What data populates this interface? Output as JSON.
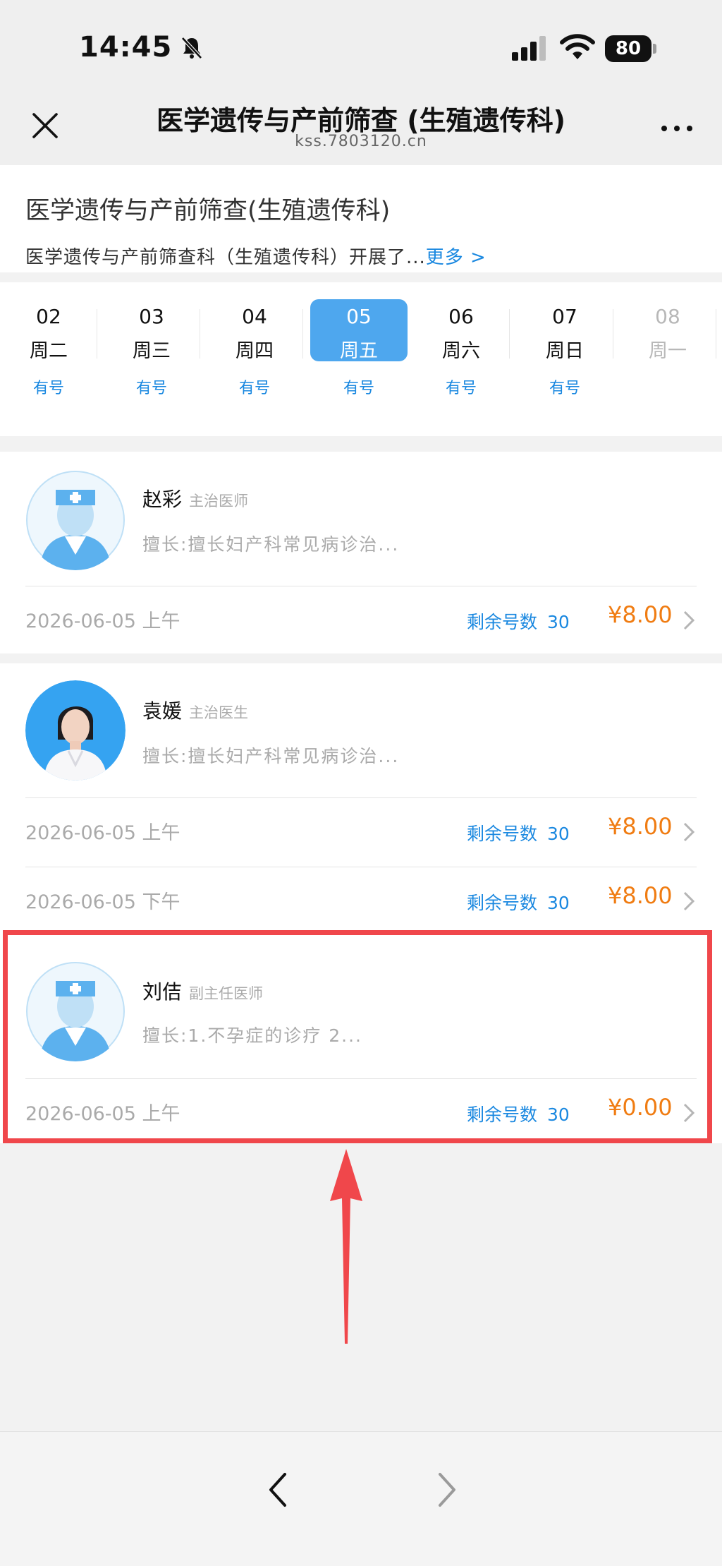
{
  "status_bar": {
    "time": "14:45",
    "battery": "80"
  },
  "nav": {
    "title": "医学遗传与产前筛查 (生殖遗传科)",
    "url": "kss.7803120.cn"
  },
  "department": {
    "name": "医学遗传与产前筛查(生殖遗传科)",
    "description": "医学遗传与产前筛查科（生殖遗传科）开展了...",
    "more_label": "更多 >"
  },
  "dates": [
    {
      "day": "02",
      "weekday": "周二",
      "status": "有号"
    },
    {
      "day": "03",
      "weekday": "周三",
      "status": "有号"
    },
    {
      "day": "04",
      "weekday": "周四",
      "status": "有号"
    },
    {
      "day": "05",
      "weekday": "周五",
      "status": "有号",
      "selected": true
    },
    {
      "day": "06",
      "weekday": "周六",
      "status": "有号"
    },
    {
      "day": "07",
      "weekday": "周日",
      "status": "有号"
    },
    {
      "day": "08",
      "weekday": "周一",
      "status": "",
      "disabled": true
    }
  ],
  "doctors": [
    {
      "name": "赵彩",
      "title": "主治医师",
      "skill": "擅长:擅长妇产科常见病诊治...",
      "avatar": "placeholder-nurse-avatar",
      "slots": [
        {
          "time": "2026-06-05 上午",
          "remain_label": "剩余号数",
          "remain": "30",
          "price": "¥8.00"
        }
      ]
    },
    {
      "name": "袁媛",
      "title": "主治医生",
      "skill": "擅长:擅长妇产科常见病诊治...",
      "avatar": "photo-avatar",
      "slots": [
        {
          "time": "2026-06-05 上午",
          "remain_label": "剩余号数",
          "remain": "30",
          "price": "¥8.00"
        },
        {
          "time": "2026-06-05 下午",
          "remain_label": "剩余号数",
          "remain": "30",
          "price": "¥8.00"
        }
      ]
    },
    {
      "name": "刘佶",
      "title": "副主任医师",
      "skill": "擅长:1.不孕症的诊疗 2...",
      "avatar": "placeholder-nurse-avatar",
      "slots": [
        {
          "time": "2026-06-05 上午",
          "remain_label": "剩余号数",
          "remain": "30",
          "price": "¥0.00"
        }
      ]
    }
  ],
  "colors": {
    "accent": "#1a88e0",
    "selected_day": "#4ea7ee",
    "price": "#f07c12",
    "highlight": "#f0474b"
  }
}
